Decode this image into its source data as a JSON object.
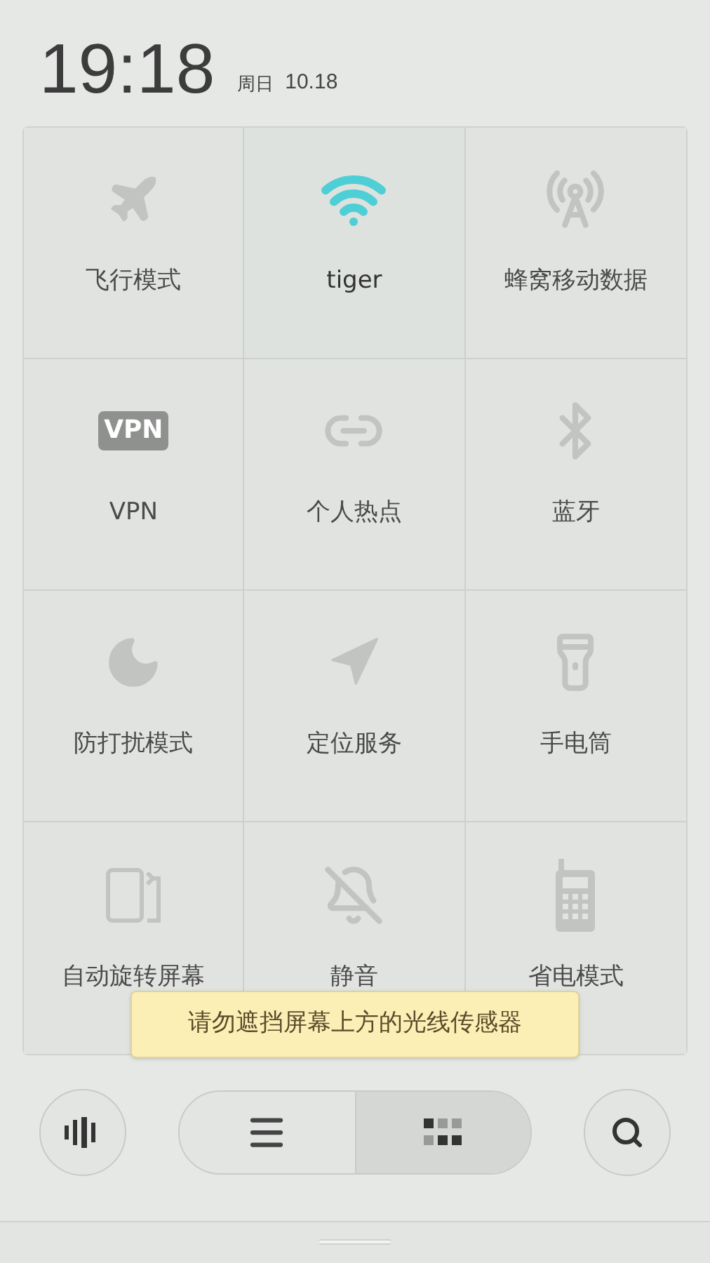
{
  "header": {
    "time": "19:18",
    "weekday": "周日",
    "date": "10.18"
  },
  "tiles": [
    {
      "kind": "airplane",
      "label": "飞行模式",
      "on": false
    },
    {
      "kind": "wifi",
      "label": "tiger",
      "on": true
    },
    {
      "kind": "cellular",
      "label": "蜂窝移动数据",
      "on": false
    },
    {
      "kind": "vpn",
      "label": "VPN",
      "badge": "VPN",
      "on": false
    },
    {
      "kind": "hotspot",
      "label": "个人热点",
      "on": false
    },
    {
      "kind": "bluetooth",
      "label": "蓝牙",
      "on": false
    },
    {
      "kind": "dnd",
      "label": "防打扰模式",
      "on": false
    },
    {
      "kind": "location",
      "label": "定位服务",
      "on": false
    },
    {
      "kind": "flashlight",
      "label": "手电筒",
      "on": false
    },
    {
      "kind": "rotate",
      "label": "自动旋转屏幕",
      "on": false
    },
    {
      "kind": "silent",
      "label": "静音",
      "on": false
    },
    {
      "kind": "power_saving",
      "label": "省电模式",
      "on": false
    }
  ],
  "toast": "请勿遮挡屏幕上方的光线传感器",
  "view_toggle": [
    {
      "kind": "list",
      "selected": false
    },
    {
      "kind": "grid",
      "selected": true
    }
  ]
}
